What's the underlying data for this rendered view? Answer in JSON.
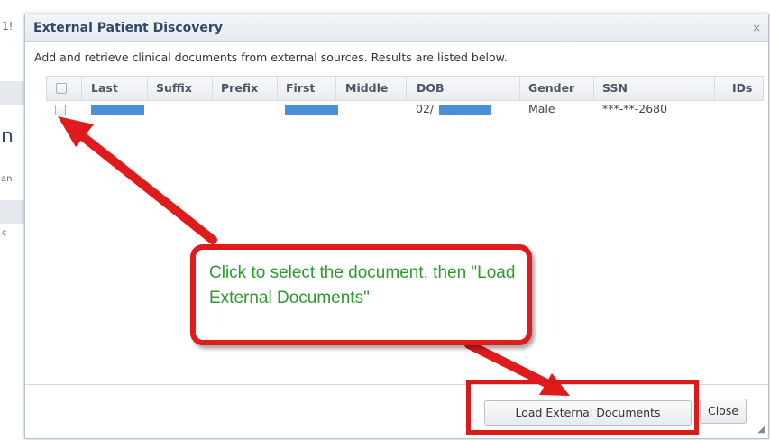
{
  "background": {
    "frag_1": "1!",
    "frag_2": "n",
    "frag_3": "an",
    "frag_4": "c"
  },
  "dialog": {
    "title": "External Patient Discovery",
    "close_glyph": "×",
    "description": "Add and retrieve clinical documents from external sources. Results are listed below.",
    "columns": [
      "Last",
      "Suffix",
      "Prefix",
      "First",
      "Middle",
      "DOB",
      "Gender",
      "SSN",
      "IDs"
    ],
    "rows": [
      {
        "last": "[redacted]",
        "suffix": "",
        "prefix": "",
        "first": "[redacted]",
        "middle": "",
        "dob": "02/",
        "gender": "Male",
        "ssn": "***-**-2680",
        "ids": ""
      }
    ],
    "buttons": {
      "load_label": "Load External Documents",
      "close_label": "Close"
    }
  },
  "annotation": {
    "callout_text": "Click to select the document, then \"Load External Documents\"",
    "color": "#e01b1b",
    "text_color": "#2e9b2e"
  },
  "colors": {
    "title": "#2f4a66",
    "redaction": "#4a8fd8"
  }
}
